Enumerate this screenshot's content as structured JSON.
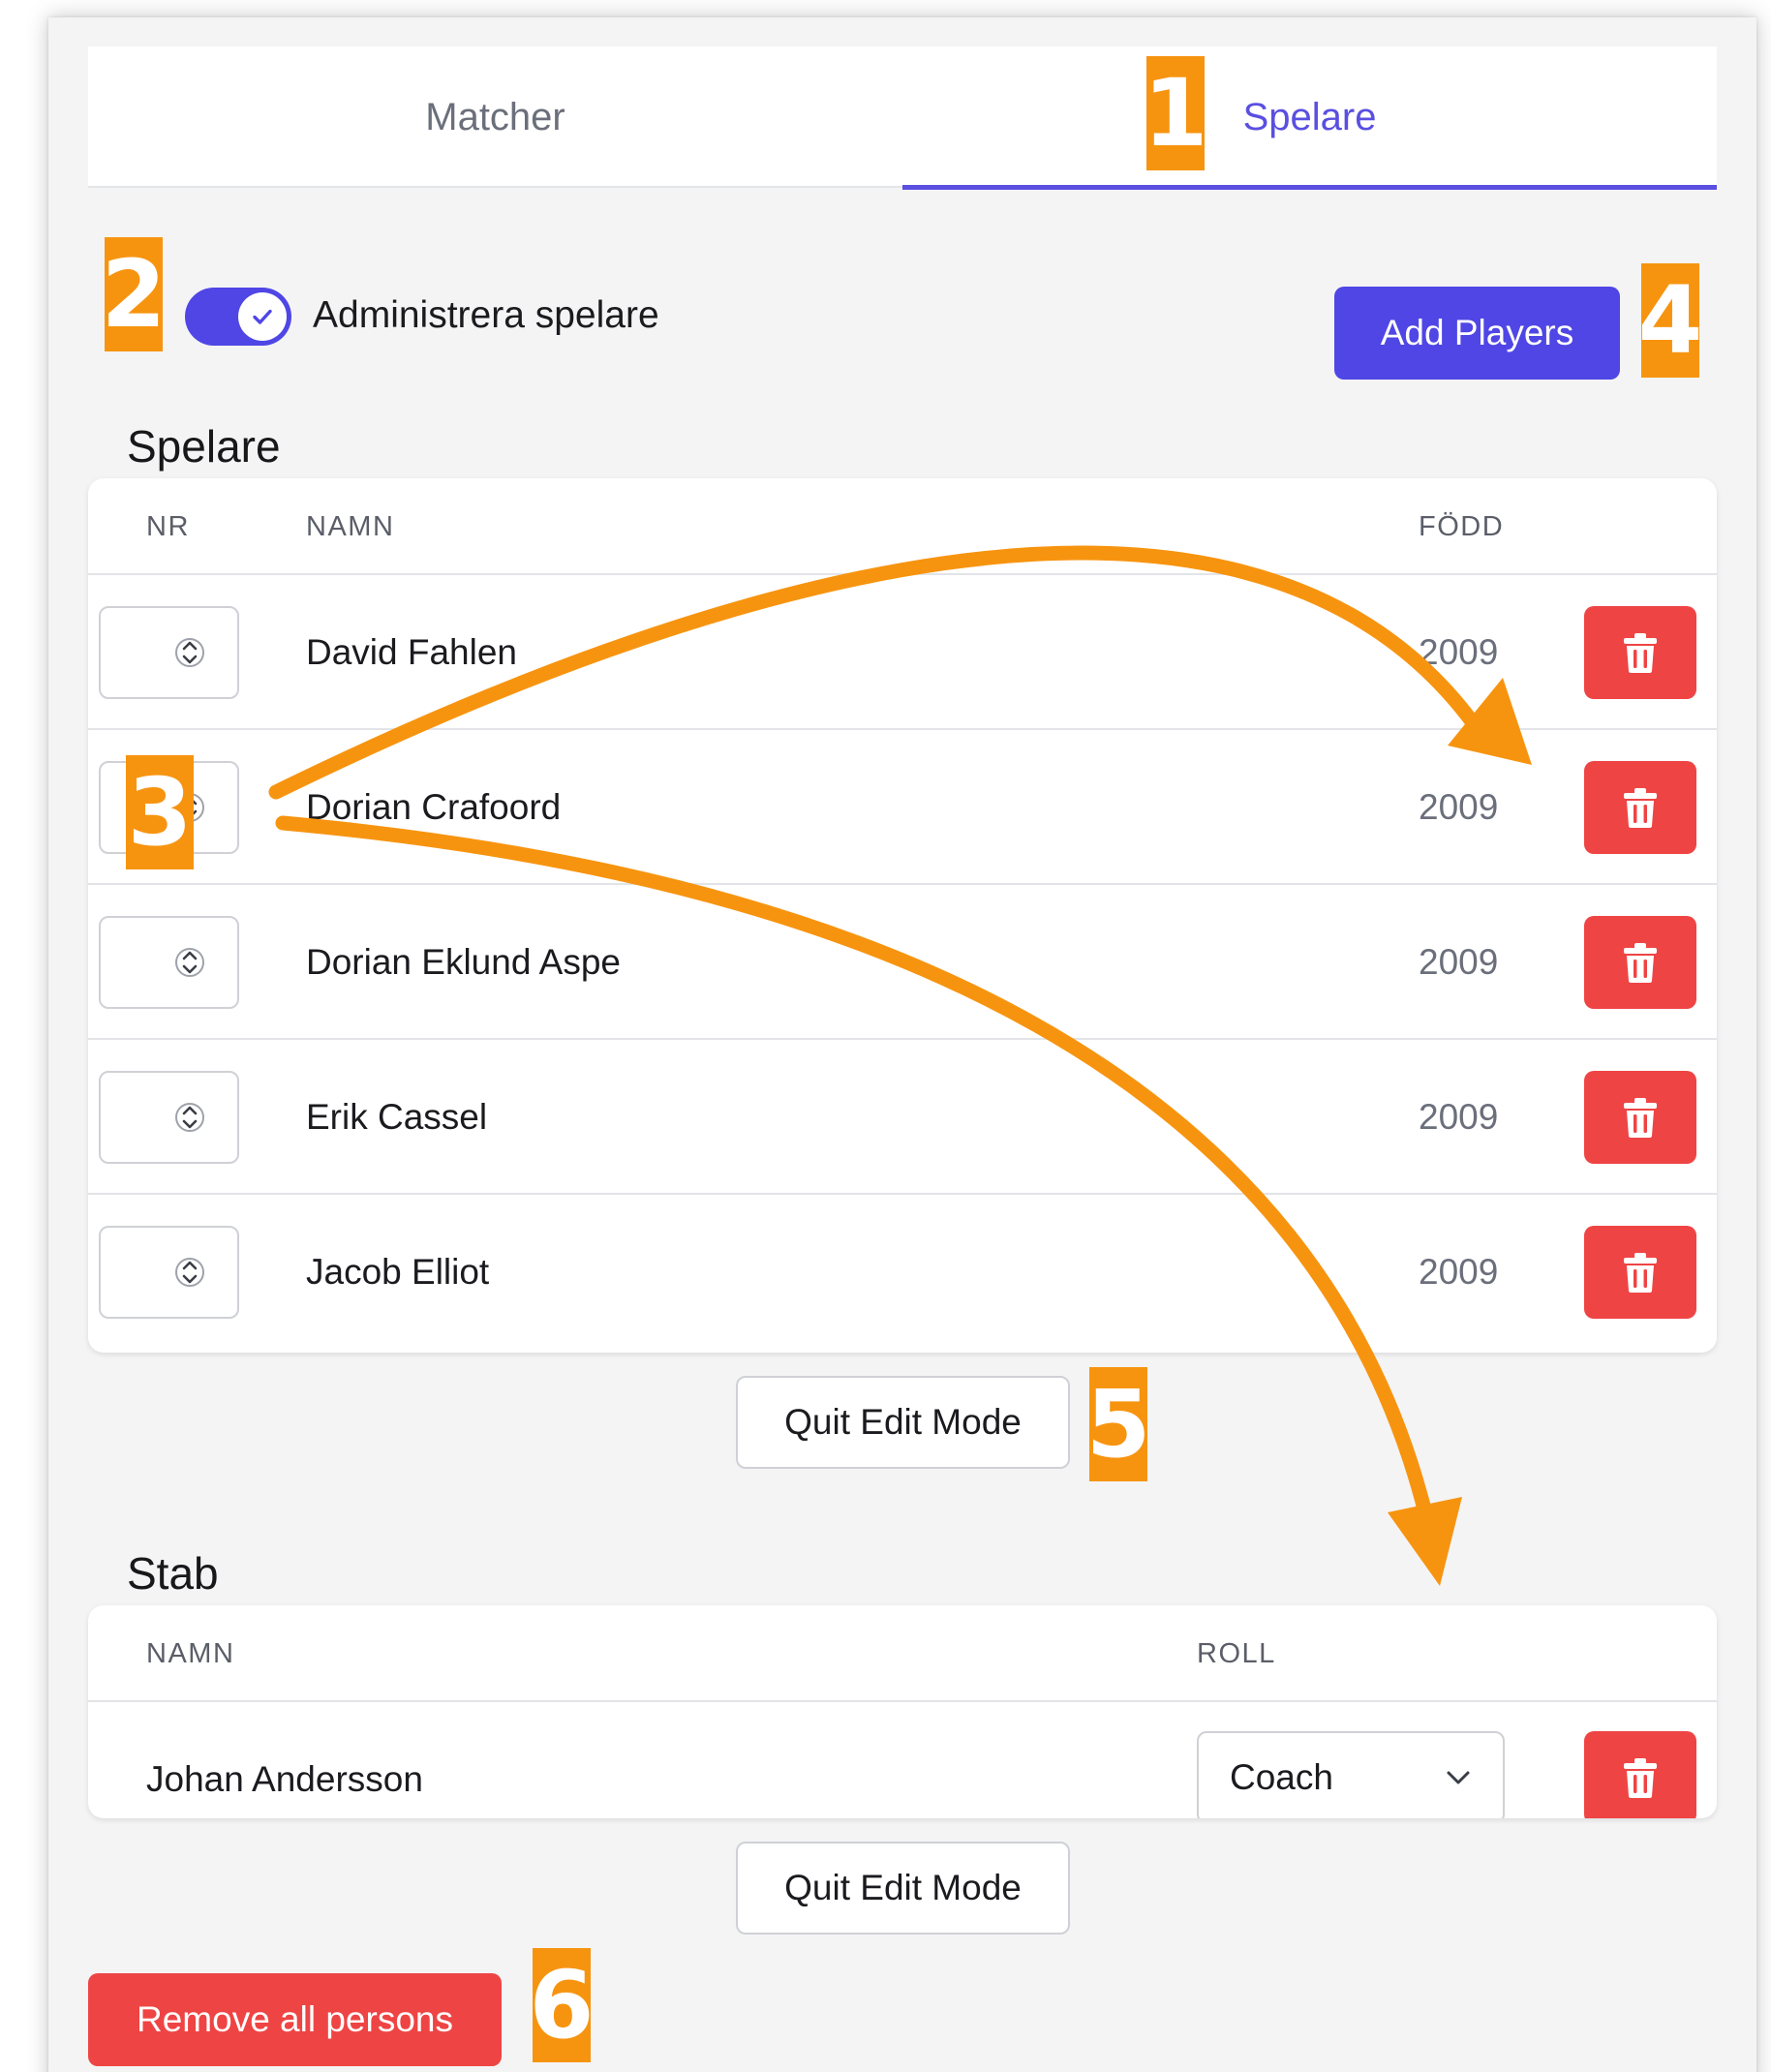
{
  "tabs": [
    {
      "label": "Matcher",
      "active": false
    },
    {
      "label": "Spelare",
      "active": true
    }
  ],
  "toggle": {
    "label": "Administrera spelare",
    "checked": true
  },
  "add_players_label": "Add Players",
  "players_section": {
    "title": "Spelare",
    "columns": {
      "nr": "NR",
      "name": "NAMN",
      "born": "FÖDD"
    },
    "rows": [
      {
        "name": "David Fahlen",
        "born": "2009"
      },
      {
        "name": "Dorian Crafoord",
        "born": "2009"
      },
      {
        "name": "Dorian Eklund Aspe",
        "born": "2009"
      },
      {
        "name": "Erik Cassel",
        "born": "2009"
      },
      {
        "name": "Jacob Elliot",
        "born": "2009"
      }
    ],
    "quit_label": "Quit Edit Mode"
  },
  "staff_section": {
    "title": "Stab",
    "columns": {
      "name": "NAMN",
      "role": "ROLL"
    },
    "rows": [
      {
        "name": "Johan Andersson",
        "role": "Coach"
      }
    ],
    "quit_label": "Quit Edit Mode"
  },
  "remove_all_label": "Remove all persons",
  "markers": [
    "1",
    "2",
    "3",
    "4",
    "5",
    "6"
  ],
  "colors": {
    "accent": "#4f46e5",
    "danger": "#ef4444",
    "marker": "#f7940f",
    "tab_active": "#5a4fe0"
  },
  "icons": {
    "toggle": "check-icon",
    "stepper": "stepper-arrows-icon",
    "delete": "trash-icon",
    "select": "chevron-down-icon"
  }
}
